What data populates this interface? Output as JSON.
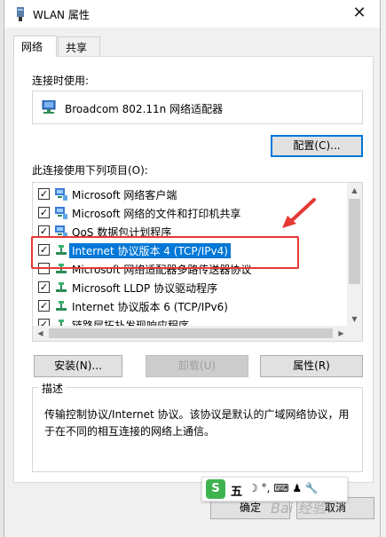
{
  "window": {
    "title": "WLAN 属性",
    "close_glyph": "✕"
  },
  "tabs": [
    {
      "label": "网络"
    },
    {
      "label": "共享"
    }
  ],
  "connect_using": {
    "label": "连接时使用:",
    "adapter": "Broadcom 802.11n 网络适配器"
  },
  "buttons": {
    "configure": "配置(C)...",
    "install": "安装(N)...",
    "uninstall": "卸载(U)",
    "properties": "属性(R)",
    "ok": "确定",
    "cancel": "取消"
  },
  "items_label": "此连接使用下列项目(O):",
  "items": [
    {
      "label": "Microsoft 网络客户端",
      "checked": true,
      "icon": "network-client-icon"
    },
    {
      "label": "Microsoft 网络的文件和打印机共享",
      "checked": true,
      "icon": "network-client-icon"
    },
    {
      "label": "QoS 数据包计划程序",
      "checked": true,
      "icon": "network-client-icon"
    },
    {
      "label": "Internet 协议版本 4 (TCP/IPv4)",
      "checked": true,
      "icon": "protocol-icon",
      "selected": true
    },
    {
      "label": "Microsoft 网络适配器多路传送器协议",
      "checked": false,
      "icon": "protocol-icon"
    },
    {
      "label": "Microsoft LLDP 协议驱动程序",
      "checked": true,
      "icon": "protocol-icon"
    },
    {
      "label": "Internet 协议版本 6 (TCP/IPv6)",
      "checked": true,
      "icon": "protocol-icon"
    },
    {
      "label": "链路层拓扑发现响应程序",
      "checked": true,
      "icon": "protocol-icon"
    }
  ],
  "description": {
    "title": "描述",
    "text": "传输控制协议/Internet 协议。该协议是默认的广域网络协议，用于在不同的相互连接的网络上通信。"
  },
  "ime_toolbar": {
    "logo": "S",
    "mode": "五",
    "symbols": "☽ °,  ⌨ ♟ 🔧"
  },
  "watermark": "Bai 经验",
  "colors": {
    "accent": "#0078d7",
    "annotation": "#e53935"
  }
}
